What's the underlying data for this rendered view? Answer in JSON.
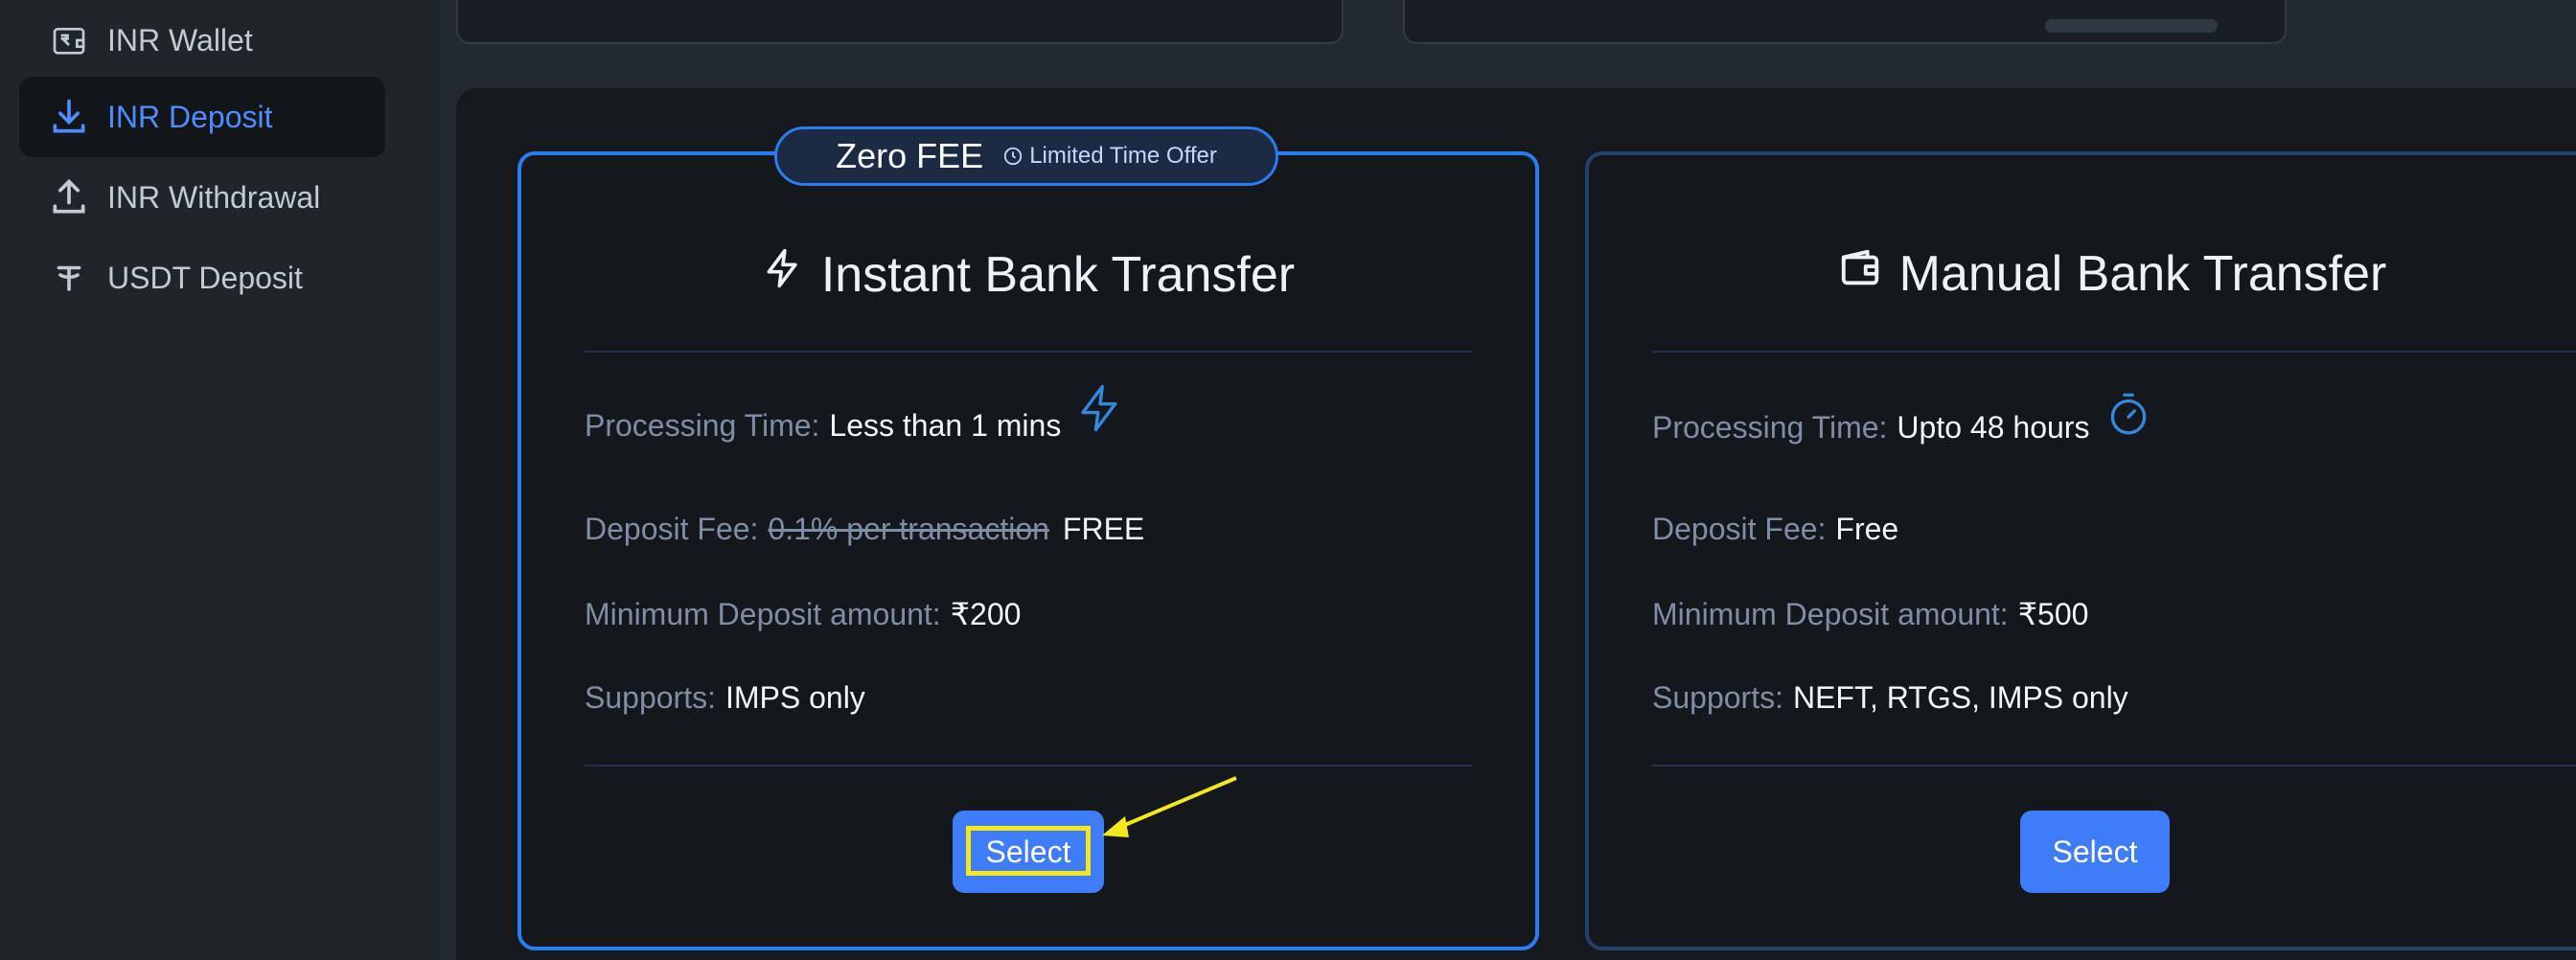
{
  "sidebar": {
    "items": [
      {
        "label": "INR Wallet",
        "icon": "wallet-icon",
        "active": false
      },
      {
        "label": "INR Deposit",
        "icon": "download-icon",
        "active": true
      },
      {
        "label": "INR Withdrawal",
        "icon": "upload-icon",
        "active": false
      },
      {
        "label": "USDT Deposit",
        "icon": "tether-icon",
        "active": false
      }
    ]
  },
  "badge": {
    "title": "Zero FEE",
    "offer": "Limited Time Offer",
    "icon": "clock-icon"
  },
  "cards": [
    {
      "title": "Instant Bank Transfer",
      "icon": "lightning-icon",
      "processing_label": "Processing Time:",
      "processing_value": "Less than 1 mins",
      "processing_icon": "lightning-outline-icon",
      "fee_label": "Deposit Fee:",
      "fee_old": "0.1% per transaction",
      "fee_value": "FREE",
      "min_label": "Minimum Deposit amount:",
      "min_value": "₹200",
      "supports_label": "Supports:",
      "supports_value": "IMPS only",
      "button_label": "Select"
    },
    {
      "title": "Manual Bank Transfer",
      "icon": "wallet-icon",
      "processing_label": "Processing Time:",
      "processing_value": "Upto 48 hours",
      "processing_icon": "stopwatch-icon",
      "fee_label": "Deposit Fee:",
      "fee_value": "Free",
      "min_label": "Minimum Deposit amount:",
      "min_value": "₹500",
      "supports_label": "Supports:",
      "supports_value": "NEFT, RTGS, IMPS only",
      "button_label": "Select"
    }
  ],
  "colors": {
    "accent": "#3f7cf7",
    "highlight": "#f4e81b",
    "active_text": "#4f8cff"
  }
}
